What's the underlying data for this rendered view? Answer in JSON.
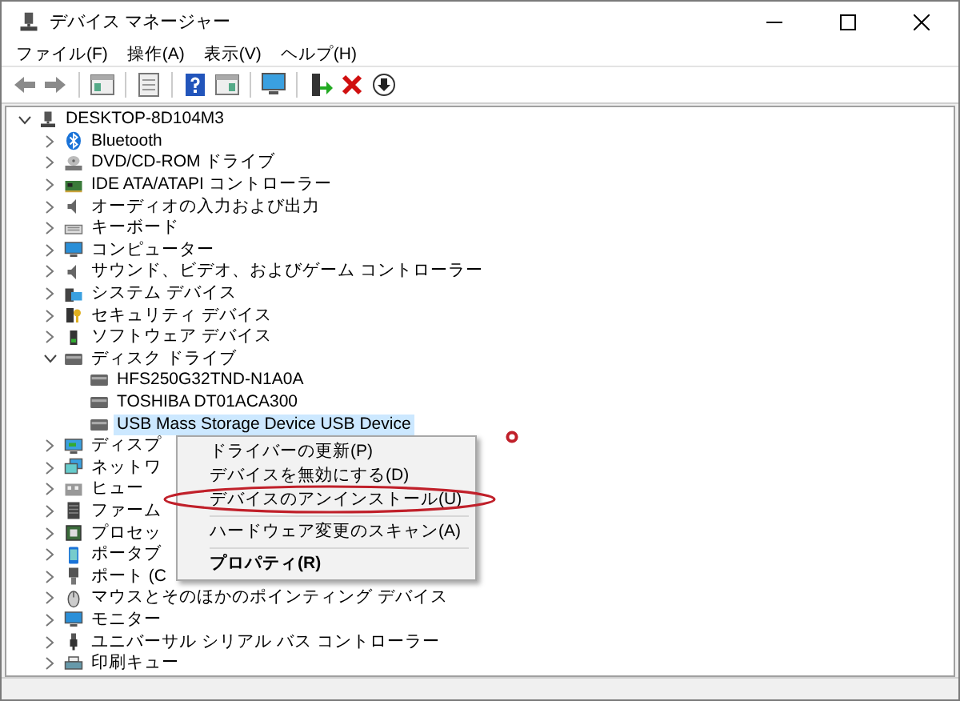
{
  "window": {
    "title": "デバイス マネージャー"
  },
  "menu_bar": [
    {
      "label": "ファイル(F)"
    },
    {
      "label": "操作(A)"
    },
    {
      "label": "表示(V)"
    },
    {
      "label": "ヘルプ(H)"
    }
  ],
  "toolbar": [
    {
      "kind": "back"
    },
    {
      "kind": "forward"
    },
    {
      "kind": "sep"
    },
    {
      "kind": "panel"
    },
    {
      "kind": "sep"
    },
    {
      "kind": "props"
    },
    {
      "kind": "sep"
    },
    {
      "kind": "help"
    },
    {
      "kind": "panel2"
    },
    {
      "kind": "sep"
    },
    {
      "kind": "scan"
    },
    {
      "kind": "sep"
    },
    {
      "kind": "update"
    },
    {
      "kind": "remove"
    },
    {
      "kind": "download"
    }
  ],
  "tree": {
    "label": "DESKTOP-8D104M3",
    "kind": "pc",
    "expanded": true,
    "selected": false,
    "children": [
      {
        "label": "Bluetooth",
        "kind": "bluetooth",
        "expanded": false,
        "selected": false
      },
      {
        "label": "DVD/CD-ROM ドライブ",
        "kind": "dvd",
        "expanded": false,
        "selected": false
      },
      {
        "label": "IDE ATA/ATAPI コントローラー",
        "kind": "card",
        "expanded": false,
        "selected": false
      },
      {
        "label": "オーディオの入力および出力",
        "kind": "speaker",
        "expanded": false,
        "selected": false
      },
      {
        "label": "キーボード",
        "kind": "keyboard",
        "expanded": false,
        "selected": false
      },
      {
        "label": "コンピューター",
        "kind": "monitor",
        "expanded": false,
        "selected": false
      },
      {
        "label": "サウンド、ビデオ、およびゲーム コントローラー",
        "kind": "speaker",
        "expanded": false,
        "selected": false
      },
      {
        "label": "システム デバイス",
        "kind": "system",
        "expanded": false,
        "selected": false
      },
      {
        "label": "セキュリティ デバイス",
        "kind": "security",
        "expanded": false,
        "selected": false
      },
      {
        "label": "ソフトウェア デバイス",
        "kind": "software",
        "expanded": false,
        "selected": false
      },
      {
        "label": "ディスク ドライブ",
        "kind": "disk",
        "expanded": true,
        "selected": false,
        "children": [
          {
            "label": "HFS250G32TND-N1A0A",
            "kind": "disk",
            "selected": false
          },
          {
            "label": "TOSHIBA DT01ACA300",
            "kind": "disk",
            "selected": false
          },
          {
            "label": "USB Mass Storage Device USB Device",
            "kind": "disk",
            "selected": true
          }
        ]
      },
      {
        "label": "ディスプ",
        "kind": "display",
        "expanded": false,
        "selected": false
      },
      {
        "label": "ネットワ",
        "kind": "network",
        "expanded": false,
        "selected": false
      },
      {
        "label": "ヒュー",
        "kind": "hid",
        "expanded": false,
        "selected": false
      },
      {
        "label": "ファーム",
        "kind": "firmware",
        "expanded": false,
        "selected": false
      },
      {
        "label": "プロセッ",
        "kind": "processor",
        "expanded": false,
        "selected": false
      },
      {
        "label": "ポータブ",
        "kind": "portable",
        "expanded": false,
        "selected": false
      },
      {
        "label": "ポート (C",
        "kind": "port",
        "expanded": false,
        "selected": false
      },
      {
        "label": "マウスとそのほかのポインティング デバイス",
        "kind": "mouse",
        "expanded": false,
        "selected": false
      },
      {
        "label": "モニター",
        "kind": "monitor",
        "expanded": false,
        "selected": false
      },
      {
        "label": "ユニバーサル シリアル バス コントローラー",
        "kind": "usb",
        "expanded": false,
        "selected": false
      },
      {
        "label": "印刷キュー",
        "kind": "printer",
        "expanded": false,
        "selected": false
      }
    ]
  },
  "context_menu": [
    {
      "kind": "item",
      "label": "ドライバーの更新(P)",
      "default": false
    },
    {
      "kind": "item",
      "label": "デバイスを無効にする(D)",
      "default": false
    },
    {
      "kind": "item",
      "label": "デバイスのアンインストール(U)",
      "default": false
    },
    {
      "kind": "separator"
    },
    {
      "kind": "item",
      "label": "ハードウェア変更のスキャン(A)",
      "default": false
    },
    {
      "kind": "separator"
    },
    {
      "kind": "item",
      "label": "プロパティ(R)",
      "default": true
    }
  ]
}
